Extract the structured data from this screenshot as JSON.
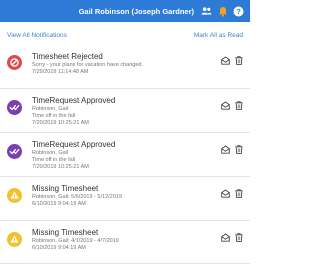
{
  "header": {
    "user": "Gail Robinson (Joseph Gardner)",
    "accent": "#2d7bd6",
    "icons": [
      "users-icon",
      "bell-icon",
      "help-icon"
    ]
  },
  "actions": {
    "view_all": "View All Notifications",
    "mark_all": "Mark All as Read"
  },
  "notifications": [
    {
      "status": "rejected",
      "color": "#e24a4a",
      "title": "Timesheet Rejected",
      "lines": [
        "Sorry - your plans for vacation have changed.",
        "7/29/2019 11:14:48 AM"
      ]
    },
    {
      "status": "approved",
      "color": "#7b3fb3",
      "title": "TimeRequest Approved",
      "lines": [
        "Robinson, Gail",
        "Time off in the fall",
        "7/20/2019 10:25:21 AM"
      ]
    },
    {
      "status": "approved",
      "color": "#7b3fb3",
      "title": "TimeRequest Approved",
      "lines": [
        "Robinson, Gail",
        "Time off in the fall",
        "7/20/2019 10:25:21 AM"
      ]
    },
    {
      "status": "missing",
      "color": "#f2c12e",
      "title": "Missing Timesheet",
      "lines": [
        "Robinson, Gail: 5/6/2019 - 5/12/2019",
        "6/10/2019 9:04:19 AM"
      ]
    },
    {
      "status": "missing",
      "color": "#f2c12e",
      "title": "Missing Timesheet",
      "lines": [
        "Robinson, Gail: 4/1/2019 - 4/7/2019",
        "6/10/2019 9:04:19 AM"
      ]
    }
  ]
}
